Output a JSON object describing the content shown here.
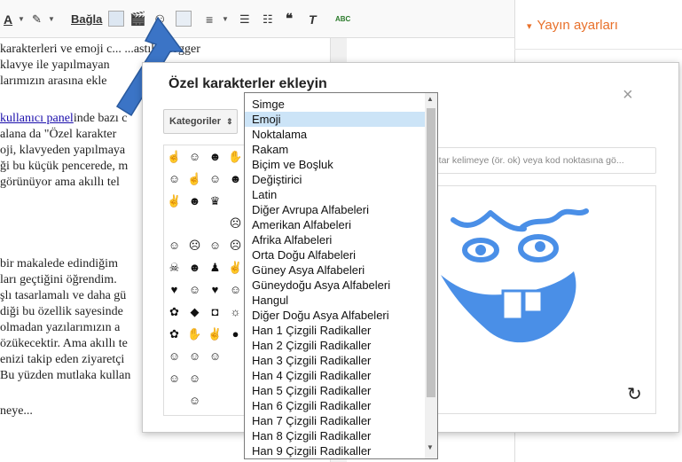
{
  "toolbar": {
    "font_color_label": "A",
    "link_label": "Bağla",
    "spellcheck_label": "ABC"
  },
  "right_panel": {
    "title": "Yayın ayarları",
    "arrow": "▾"
  },
  "editor": {
    "lines": [
      " karakterleri ve emoji c...   ...astık Blogger",
      " klavye ile yapılmayan",
      "larımızın arasına ekle",
      "",
      "kullanıcı panelinde bazı c",
      " alana da \"Özel karakter",
      "oji, klavyeden yapılmaya",
      "ği bu küçük pencerede, m",
      " görünüyor ama akıllı tel",
      "",
      "",
      "",
      "",
      " bir makalede edindiğim",
      "ları geçtiğini öğrendim. ",
      "şlı tasarlamalı ve daha gü",
      "diği bu özellik sayesinde ",
      " olmadan yazılarımızın a",
      "özükecektir. Ama akıllı te",
      "enizi takip eden ziyaretçi",
      "Bu yüzden mutlaka kullan",
      "",
      "neye..."
    ],
    "link_text": "kullanıcı panel"
  },
  "dialog": {
    "title": "Özel karakterler ekleyin",
    "close": "×",
    "category_button": "Kategoriler",
    "search_placeholder": "ahtar kelimeye (ör. ok) veya kod noktasına gö...",
    "reset_icon": "↻"
  },
  "dropdown": {
    "options": [
      "Simge",
      "Emoji",
      "Noktalama",
      "Rakam",
      "Biçim ve Boşluk",
      "Değiştirici",
      "Latin",
      "Diğer Avrupa Alfabeleri",
      "Amerikan Alfabeleri",
      "Afrika Alfabeleri",
      "Orta Doğu Alfabeleri",
      "Güney Asya Alfabeleri",
      "Güneydoğu Asya Alfabeleri",
      "Hangul",
      "Diğer Doğu Asya Alfabeleri",
      "Han 1 Çizgili Radikaller",
      "Han 2 Çizgili Radikaller",
      "Han 3 Çizgili Radikaller",
      "Han 4 Çizgili Radikaller",
      "Han 5 Çizgili Radikaller",
      "Han 6 Çizgili Radikaller",
      "Han 7 Çizgili Radikaller",
      "Han 8 Çizgili Radikaller",
      "Han 9 Çizgili Radikaller"
    ],
    "selected": "Emoji"
  },
  "emoji_grid": [
    [
      "☝",
      "☺",
      "☻",
      "✋"
    ],
    [
      "☺",
      "☝",
      "☺",
      "☻"
    ],
    [
      "✌",
      "☻",
      "♛",
      ""
    ],
    [
      "",
      "",
      "",
      "☹"
    ],
    [
      "☺",
      "☹",
      "☺",
      "☹"
    ],
    [
      "☠",
      "☻",
      "♟",
      "✌"
    ],
    [
      "♥",
      "☺",
      "♥",
      "☺"
    ],
    [
      "✿",
      "◆",
      "◘",
      "☼"
    ],
    [
      "✿",
      "✋",
      "✌",
      "●"
    ],
    [
      "☺",
      "☺",
      "☺",
      ""
    ],
    [
      "☺",
      "☺",
      "",
      ""
    ],
    [
      "",
      "☺",
      "",
      ""
    ]
  ],
  "colors": {
    "accent": "#e8702a",
    "drawing": "#4a8fe7",
    "selected": "#cce4f7",
    "arrow": "#3b74c6"
  }
}
